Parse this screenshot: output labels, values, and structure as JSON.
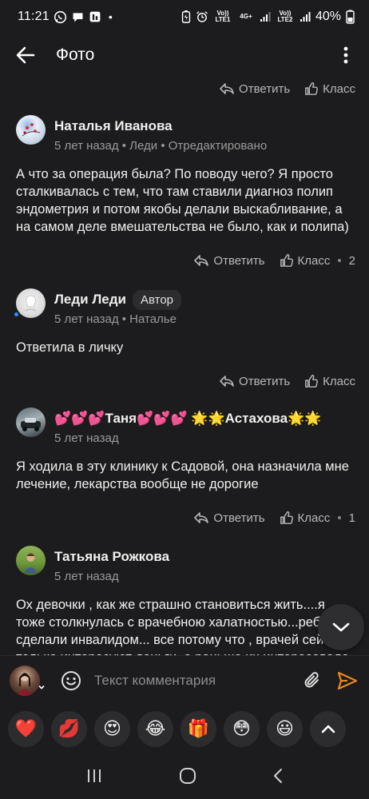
{
  "status_bar": {
    "time": "11:21",
    "left_icons": [
      "whatsapp-icon",
      "chat-bubble-icon",
      "news-icon"
    ],
    "dot": "•",
    "volte1": "Vo)) LTE1",
    "net1": "4G+",
    "volte2": "Vo)) LTE2",
    "battery": "40%"
  },
  "app_bar": {
    "title": "Фото"
  },
  "labels": {
    "reply": "Ответить",
    "like": "Класс",
    "sep": "•"
  },
  "top_actions": {
    "count": ""
  },
  "comments": [
    {
      "name": "Наталья Иванова",
      "badge": "",
      "meta": "5 лет назад • Леди • Отредактировано",
      "text": "А что за операция была? По поводу чего? Я просто сталкивалась с тем, что там ставили диагноз полип эндометрия и потом якобы делали выскабливание, а на самом деле вмешательства не было, как и полипа)",
      "likes": "2"
    },
    {
      "name": "Леди Леди",
      "badge": "Автор",
      "meta": "5 лет назад • Наталье",
      "text": "Ответила в личку",
      "likes": ""
    },
    {
      "name": "💕💕💕Таня💕💕💕 🌟🌟Астахова🌟🌟",
      "badge": "",
      "meta": "5 лет назад",
      "text": "Я ходила в эту клинику к Садовой, она назначила мне лечение, лекарства вообще не дорогие",
      "likes": "1"
    },
    {
      "name": "Татьяна Рожкова",
      "badge": "",
      "meta": "5 лет назад",
      "text": "Ох девочки , как же страшно становиться жить....я тоже столкнулась с врачебною халатностью...ребенка сделали инвалидом... все потому что , врачей сейчас только интересуют деньги, а раньше их интересовало",
      "likes": ""
    }
  ],
  "composer": {
    "placeholder": "Текст комментария"
  },
  "emoji_bar": {
    "items": [
      "❤️",
      "💋",
      "😍",
      "😂",
      "🎁",
      "😳",
      "😃"
    ]
  },
  "colors": {
    "background": "#1c1c1e",
    "accent_send": "#e8891d",
    "online_dot": "#2f8cff"
  }
}
